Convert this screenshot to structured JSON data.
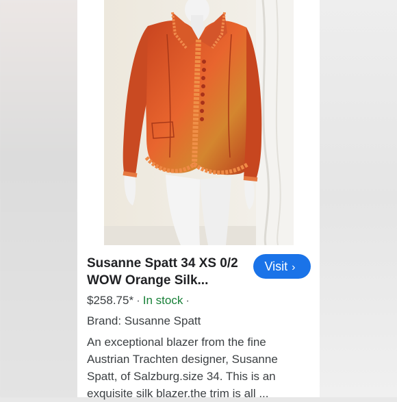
{
  "product": {
    "title": "Susanne Spatt 34 XS 0/2 WOW Orange Silk...",
    "price": "$258.75*",
    "separator": "·",
    "availability": "In stock",
    "brand_line": "Brand: Susanne Spatt",
    "description": "An exceptional blazer from the fine Austrian Trachten designer, Susanne Spatt, of Salzburg.size 34. This is an exquisite silk blazer.the trim is all ..."
  },
  "actions": {
    "visit_label": "Visit",
    "visit_chevron": "›"
  },
  "colors": {
    "accent": "#1a73e8",
    "in_stock": "#188038",
    "jacket": "#e0542a"
  }
}
